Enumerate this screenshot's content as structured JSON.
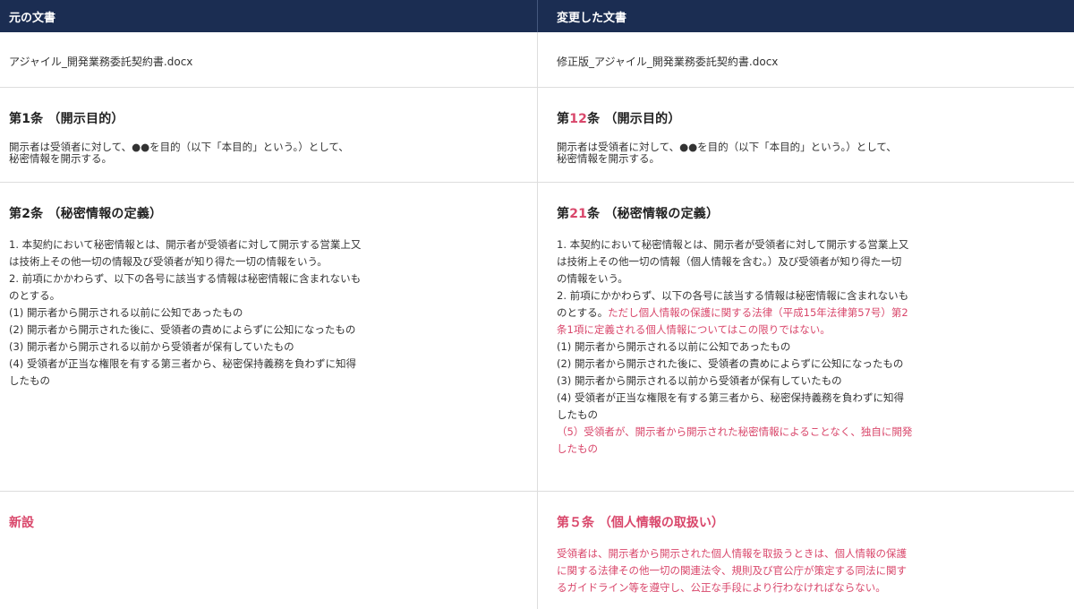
{
  "header": {
    "original_label": "元の文書",
    "modified_label": "変更した文書"
  },
  "files": {
    "original_name": "アジャイル_開発業務委託契約書.docx",
    "modified_name": "修正版_アジャイル_開発業務委託契約書.docx"
  },
  "article1": {
    "original_title": "第1条 （開示目的）",
    "modified_title_prefix": "第",
    "modified_title_num_plain": "1",
    "modified_title_num_changed": "2",
    "modified_title_suffix": "条 （開示目的）",
    "body_line1": "開示者は受領者に対して、●●を目的（以下「本目的」という。）として、",
    "body_line2": "秘密情報を開示する。"
  },
  "article2": {
    "original_title": "第2条 （秘密情報の定義）",
    "modified_title_prefix": "第",
    "modified_title_num_changed": "2",
    "modified_title_num_plain": "1",
    "modified_title_suffix": "条 （秘密情報の定義）",
    "original_lines": [
      "1. 本契約において秘密情報とは、開示者が受領者に対して開示する営業上又",
      "は技術上その他一切の情報及び受領者が知り得た一切の情報をいう。",
      "2. 前項にかかわらず、以下の各号に該当する情報は秘密情報に含まれないも",
      "のとする。",
      "(1) 開示者から開示される以前に公知であったもの",
      "(2) 開示者から開示された後に、受領者の責めによらずに公知になったもの",
      "(3) 開示者から開示される以前から受領者が保有していたもの",
      "(4) 受領者が正当な権限を有する第三者から、秘密保持義務を負わずに知得",
      "したもの"
    ],
    "modified_lines_before": [
      " 1. 本契約において秘密情報とは、開示者が受領者に対して開示する営業上又",
      "は技術上その他一切の情報（個人情報を含む。）及び受領者が知り得た一切",
      "の情報をいう。",
      "2. 前項にかかわらず、以下の各号に該当する情報は秘密情報に含まれないも"
    ],
    "modified_line_mixed_plain": "のとする。",
    "modified_line_mixed_red": "ただし個人情報の保護に関する法律（平成15年法律第57号）第2",
    "modified_line_red_cont": "条1項に定義される個人情報についてはこの限りではない。",
    "modified_lines_after": [
      "(1) 開示者から開示される以前に公知であったもの",
      "(2) 開示者から開示された後に、受領者の責めによらずに公知になったもの",
      "(3) 開示者から開示される以前から受領者が保有していたもの",
      "(4) 受領者が正当な権限を有する第三者から、秘密保持義務を負わずに知得",
      "したもの"
    ],
    "modified_added_lines": [
      "（5）受領者が、開示者から開示された秘密情報によることなく、独自に開発",
      "したもの"
    ]
  },
  "article5": {
    "original_label": "新設",
    "modified_title": "第５条 （個人情報の取扱い）",
    "body_lines": [
      " 受領者は、開示者から開示された個人情報を取扱うときは、個人情報の保護",
      "に関する法律その他一切の関連法令、規則及び官公庁が策定する同法に関す",
      "るガイドライン等を遵守し、公正な手段により行わなければならない。"
    ]
  },
  "colors": {
    "header_bg": "#1b2d52",
    "change_red": "#d9476b",
    "divider": "#dddddd"
  }
}
